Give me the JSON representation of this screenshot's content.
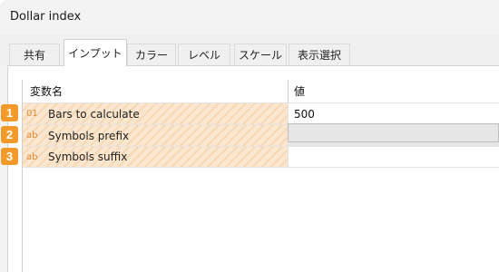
{
  "window": {
    "title": "Dollar index"
  },
  "tabs": [
    "共有",
    "インプット",
    "カラー",
    "レベル",
    "スケール",
    "表示選択"
  ],
  "active_tab": "インプット",
  "grid": {
    "headers": {
      "name": "変数名",
      "value": "値"
    },
    "rows": [
      {
        "badge": "1",
        "type_icon": "01",
        "label": "Bars to calculate",
        "value": "500"
      },
      {
        "badge": "2",
        "type_icon": "ab",
        "label": "Symbols prefix",
        "value": ""
      },
      {
        "badge": "3",
        "type_icon": "ab",
        "label": "Symbols suffix",
        "value": ""
      }
    ]
  },
  "colors": {
    "badge": "#f39a2b",
    "row_hatch": "#fbe6cf",
    "type_icon": "#d9892e"
  }
}
